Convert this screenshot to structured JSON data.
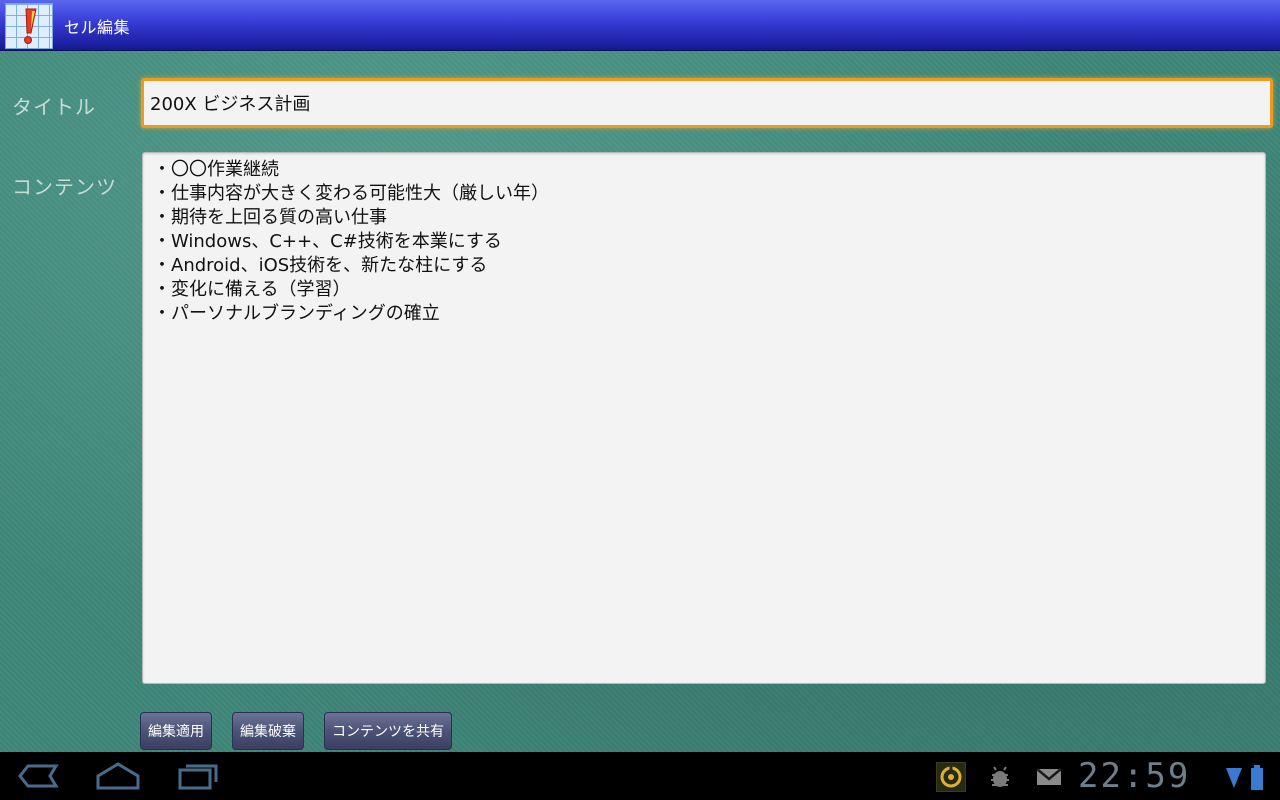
{
  "app": {
    "title": "セル編集"
  },
  "form": {
    "title_label": "タイトル",
    "title_value": "200X ビジネス計画",
    "contents_label": "コンテンツ",
    "contents_lines": [
      "・〇〇作業継続",
      "・仕事内容が大きく変わる可能性大（厳しい年）",
      "・期待を上回る質の高い仕事",
      "・Windows、C++、C#技術を本業にする",
      "・Android、iOS技術を、新たな柱にする",
      "・変化に備える（学習）",
      "・パーソナルブランディングの確立"
    ]
  },
  "buttons": {
    "apply": "編集適用",
    "discard": "編集破棄",
    "share": "コンテンツを共有"
  },
  "statusbar": {
    "time": "22:59"
  },
  "icons": {
    "app": "exclamation-grid-icon",
    "back": "back-icon",
    "home": "home-icon",
    "recent": "recent-apps-icon",
    "notification1": "sync-icon",
    "notification2": "android-debug-icon",
    "notification3": "gmail-icon",
    "wifi": "wifi-icon",
    "battery": "battery-icon"
  },
  "colors": {
    "titlebar": "#2a2fc0",
    "background": "#3f8779",
    "focus_border": "#f09a1d",
    "button": "#4d5377",
    "navbar": "#000000"
  }
}
